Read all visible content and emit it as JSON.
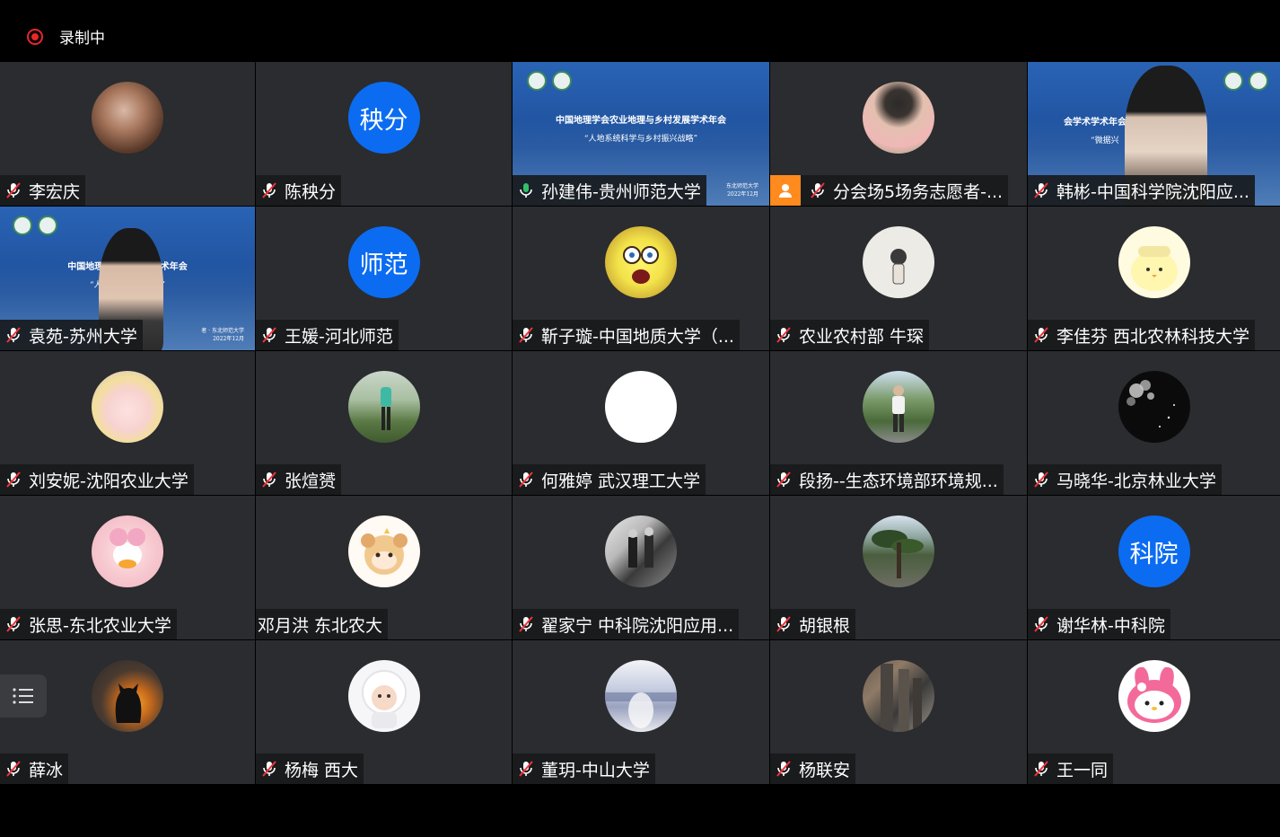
{
  "recording": {
    "label": "录制中",
    "color": "#e8262b"
  },
  "accent_active": "#2fc06a",
  "avatar_text_color": "#0b6cf2",
  "shared_screen": {
    "title": "中国地理学会农业地理与乡村发展学术年会",
    "subtitle": "“人地系统科学与乡村振兴战略”",
    "foot1": "东北师范大学",
    "foot2": "2022年12月",
    "title_partial_right": "会学术学术年会 国中",
    "subtitle_partial_right": "“微据兴",
    "title_partial_left": "中国地理学会农 发展学术年会",
    "subtitle_partial_left": "“人地系统 振兴战略”",
    "foot_partial": "者 · 东北师范大学",
    "foot_partial2": "2022年12月"
  },
  "participants": [
    {
      "name": "李宏庆",
      "mic": "muted",
      "avatar": "photo-woman-profile"
    },
    {
      "name": "陈秧分",
      "mic": "muted",
      "avatar_text": "秧分"
    },
    {
      "name": "孙建伟-贵州师范大学",
      "mic": "active",
      "avatar": "shared-screen"
    },
    {
      "name": "分会场5场务志愿者-...",
      "mic": "muted",
      "avatar": "photo-woman-flower",
      "host": true
    },
    {
      "name": "韩彬-中国科学院沈阳应...",
      "mic": "muted",
      "avatar": "video-woman-glasses"
    },
    {
      "name": "袁苑-苏州大学",
      "mic": "muted",
      "avatar": "video-woman-screen"
    },
    {
      "name": "王媛-河北师范",
      "mic": "muted",
      "avatar_text": "师范"
    },
    {
      "name": "靳子璇-中国地质大学（...",
      "mic": "muted",
      "avatar": "cartoon-sponge"
    },
    {
      "name": "农业农村部 牛琛",
      "mic": "muted",
      "avatar": "sketch-girl"
    },
    {
      "name": "李佳芬 西北农林科技大学",
      "mic": "muted",
      "avatar": "cartoon-chick"
    },
    {
      "name": "刘安妮-沈阳农业大学",
      "mic": "muted",
      "avatar": "anime-girl"
    },
    {
      "name": "张煊赟",
      "mic": "muted",
      "avatar": "photo-field"
    },
    {
      "name": "何雅婷 武汉理工大学",
      "mic": "muted",
      "avatar": "blank-white"
    },
    {
      "name": "段扬--生态环境部环境规...",
      "mic": "muted",
      "avatar": "photo-runner"
    },
    {
      "name": "马晓华-北京林业大学",
      "mic": "muted",
      "avatar": "photo-night-tree"
    },
    {
      "name": "张思-东北农业大学",
      "mic": "muted",
      "avatar": "cartoon-duck"
    },
    {
      "name": "邓月洪 东北农大",
      "mic": "none",
      "avatar": "cartoon-bear"
    },
    {
      "name": "翟家宁 中科院沈阳应用...",
      "mic": "muted",
      "avatar": "photo-dancers"
    },
    {
      "name": "胡银根",
      "mic": "muted",
      "avatar": "photo-pine"
    },
    {
      "name": "谢华林-中科院",
      "mic": "muted",
      "avatar_text": "科院"
    },
    {
      "name": "薛冰",
      "mic": "muted",
      "avatar": "photo-cat-sunset"
    },
    {
      "name": "杨梅 西大",
      "mic": "muted",
      "avatar": "photo-baby"
    },
    {
      "name": "董玥-中山大学",
      "mic": "muted",
      "avatar": "photo-blur-girl"
    },
    {
      "name": "杨联安",
      "mic": "muted",
      "avatar": "photo-buildings"
    },
    {
      "name": "王一同",
      "mic": "muted",
      "avatar": "cartoon-melody"
    }
  ]
}
